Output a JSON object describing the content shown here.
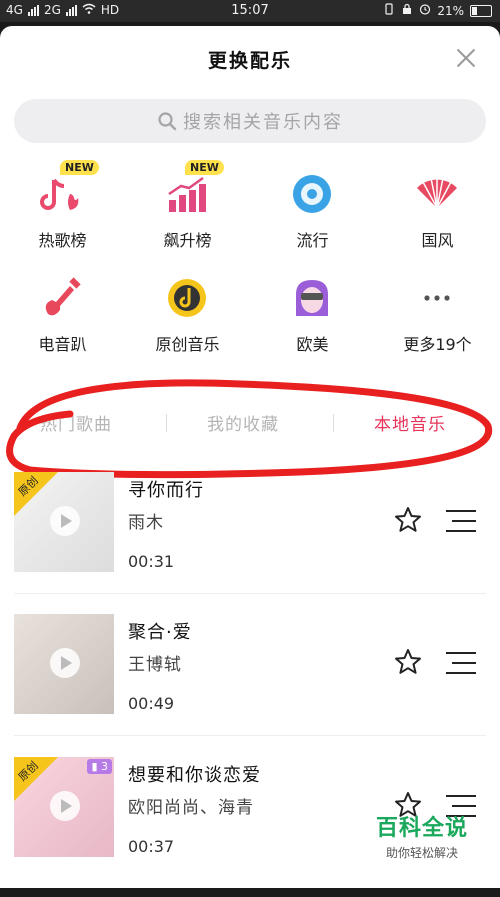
{
  "status_bar": {
    "network_1": "4G",
    "network_2": "2G",
    "carrier": "HD",
    "time": "15:07",
    "battery": "21%"
  },
  "sheet": {
    "title": "更换配乐",
    "search_placeholder": "搜索相关音乐内容"
  },
  "categories": [
    {
      "label": "热歌榜",
      "badge": "NEW",
      "icon": "hot-chart-icon",
      "color": "#ea4a6d"
    },
    {
      "label": "飙升榜",
      "badge": "NEW",
      "icon": "rising-chart-icon",
      "color": "#e0487f"
    },
    {
      "label": "流行",
      "badge": "",
      "icon": "pop-disc-icon",
      "color": "#3aa3e6"
    },
    {
      "label": "国风",
      "badge": "",
      "icon": "fan-icon",
      "color": "#e84a62"
    },
    {
      "label": "电音趴",
      "badge": "",
      "icon": "electric-guitar-icon",
      "color": "#e8485c"
    },
    {
      "label": "原创音乐",
      "badge": "",
      "icon": "original-music-icon",
      "color": "#f6c51c"
    },
    {
      "label": "欧美",
      "badge": "",
      "icon": "western-face-icon",
      "color": "#9a5fd8"
    },
    {
      "label": "更多19个",
      "badge": "",
      "icon": "more-dots-icon",
      "color": "#555555"
    }
  ],
  "tabs": [
    {
      "label": "热门歌曲",
      "active": false
    },
    {
      "label": "我的收藏",
      "active": false
    },
    {
      "label": "本地音乐",
      "active": true
    }
  ],
  "songs": [
    {
      "name": "寻你而行",
      "artist": "雨木",
      "duration": "00:31",
      "ribbon": "原创",
      "count": ""
    },
    {
      "name": "聚合·爱",
      "artist": "王博轼",
      "duration": "00:49",
      "ribbon": "",
      "count": ""
    },
    {
      "name": "想要和你谈恋爱",
      "artist": "欧阳尚尚、海青",
      "duration": "00:37",
      "ribbon": "原创",
      "count": "3"
    }
  ],
  "watermark": {
    "line1": "百科全说",
    "line2": "助你轻松解决"
  },
  "colors": {
    "accent": "#e8335a",
    "annotation": "#e8201f"
  }
}
